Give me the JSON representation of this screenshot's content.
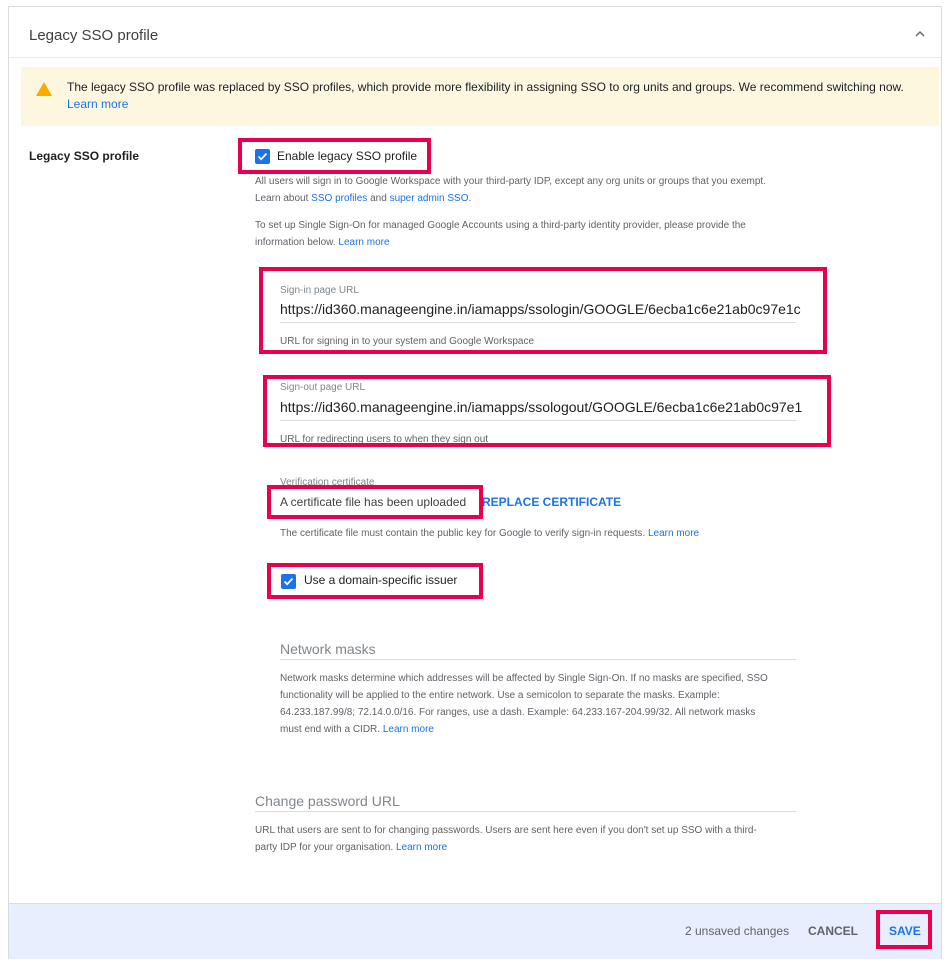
{
  "card": {
    "title": "Legacy SSO profile"
  },
  "banner": {
    "text": "The legacy SSO profile was replaced by SSO profiles, which provide more flexibility in assigning SSO to org units and groups. We recommend switching now.",
    "link": "Learn more"
  },
  "section": {
    "label": "Legacy SSO profile",
    "enable_checkbox_label": "Enable legacy SSO profile",
    "enable_checked": true,
    "desc1_part1": "All users will sign in to Google Workspace with your third-party IDP, except any org units or groups that you exempt.",
    "desc1_part2": "Learn about",
    "desc1_link1": "SSO profiles",
    "desc1_and": "and",
    "desc1_link2": "super admin SSO",
    "desc1_period": ".",
    "desc2_part1": "To set up Single Sign-On for managed Google Accounts using a third-party identity provider, please provide the",
    "desc2_part2": "information below.",
    "desc2_link": "Learn more"
  },
  "signin": {
    "label": "Sign-in page URL",
    "value": "https://id360.manageengine.in/iamapps/ssologin/GOOGLE/6ecba1c6e21ab0c97e1c",
    "helper": "URL for signing in to your system and Google Workspace"
  },
  "signout": {
    "label": "Sign-out page URL",
    "value": "https://id360.manageengine.in/iamapps/ssologout/GOOGLE/6ecba1c6e21ab0c97e1",
    "helper": "URL for redirecting users to when they sign out"
  },
  "certificate": {
    "label": "Verification certificate",
    "status": "A certificate file has been uploaded",
    "replace_button": "REPLACE CERTIFICATE",
    "helper": "The certificate file must contain the public key for Google to verify sign-in requests.",
    "helper_link": "Learn more"
  },
  "issuer": {
    "label": "Use a domain-specific issuer",
    "checked": true
  },
  "network_masks": {
    "placeholder": "Network masks",
    "line1": "Network masks determine which addresses will be affected by Single Sign-On. If no masks are specified, SSO",
    "line2": "functionality will be applied to the entire network. Use a semicolon to separate the masks. Example:",
    "line3": "64.233.187.99/8; 72.14.0.0/16. For ranges, use a dash. Example: 64.233.167-204.99/32. All network masks",
    "line4": "must end with a CIDR.",
    "link": "Learn more"
  },
  "change_password": {
    "placeholder": "Change password URL",
    "line1": "URL that users are sent to for changing passwords. Users are sent here even if you don't set up SSO with a third-",
    "line2": "party IDP for your organisation.",
    "link": "Learn more"
  },
  "footer": {
    "unsaved": "2 unsaved changes",
    "cancel": "CANCEL",
    "save": "SAVE"
  },
  "colors": {
    "accent": "#1a73e8",
    "highlight": "#e8004c",
    "banner_bg": "#fef7e0",
    "warning": "#f9ab00"
  }
}
